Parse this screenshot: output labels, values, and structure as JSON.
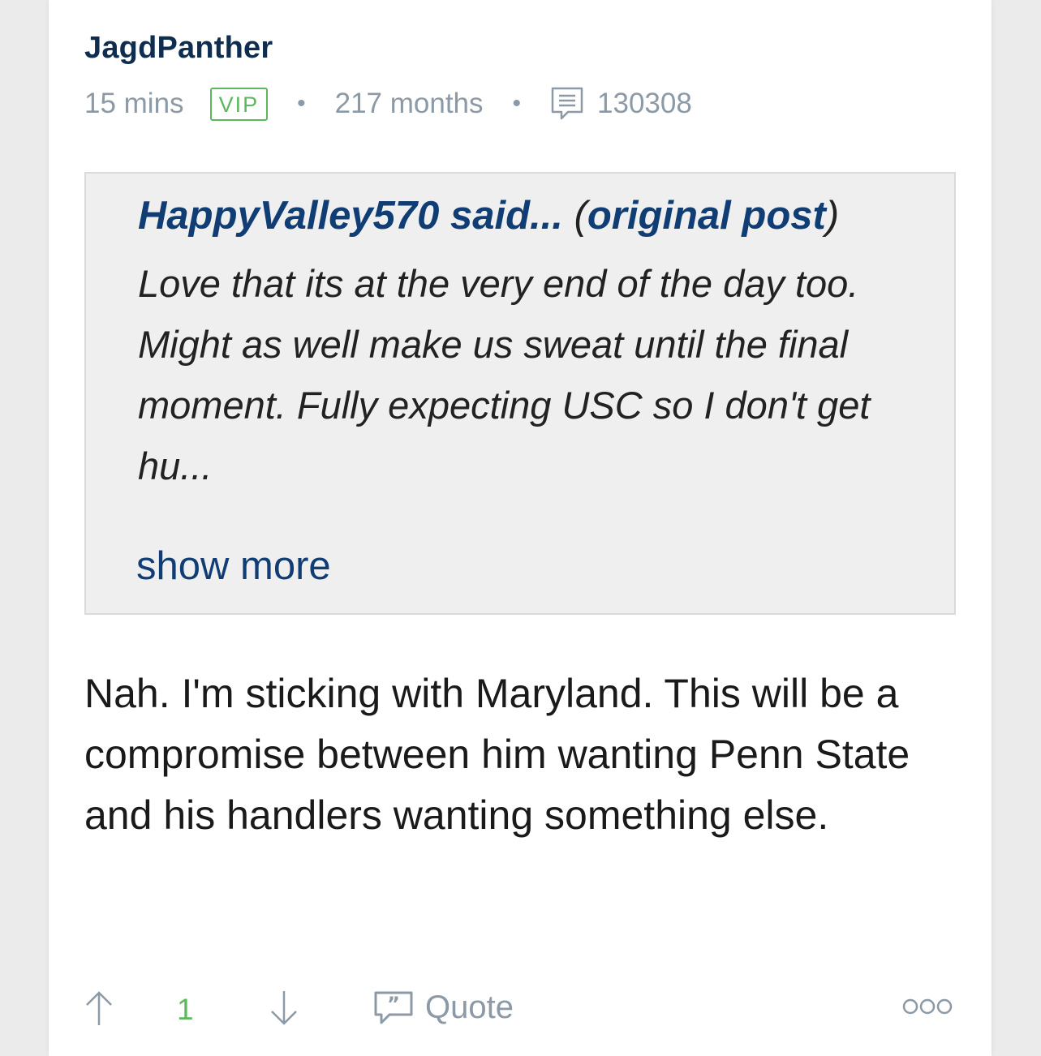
{
  "post": {
    "author": "JagdPanther",
    "time": "15 mins",
    "badge": "VIP",
    "tenure": "217 months",
    "message_count": "130308",
    "quote": {
      "author": "HappyValley570",
      "said": "said...",
      "open_paren": "(",
      "original_post": "original post",
      "close_paren": ")",
      "text": "Love that its at the very end of the day too. Might as well make us sweat until the final moment. Fully expecting USC so I don't get hu...",
      "show_more": "show more"
    },
    "body": "Nah. I'm sticking with Maryland. This will be a compromise between him wanting Penn State and his handlers wanting something else.",
    "actions": {
      "vote_count": "1",
      "quote_label": "Quote"
    }
  },
  "colors": {
    "author": "#0f2d4f",
    "link": "#0f3d74",
    "vip": "#5cb85c",
    "meta": "#8c99a6"
  }
}
